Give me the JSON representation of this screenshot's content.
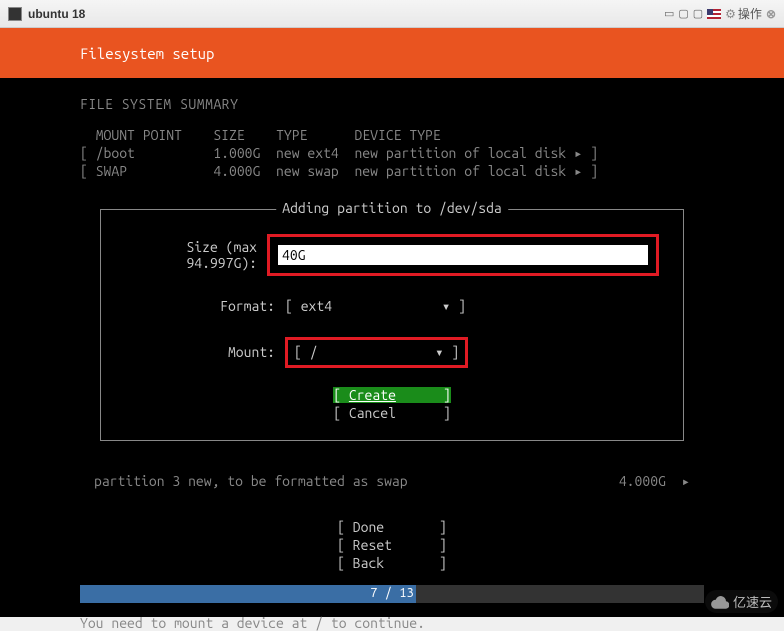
{
  "titlebar": {
    "title": "ubuntu 18",
    "operate_label": "操作"
  },
  "header": {
    "title": "Filesystem setup"
  },
  "summary": {
    "title": "FILE SYSTEM SUMMARY",
    "headers": {
      "mount": "MOUNT POINT",
      "size": "SIZE",
      "type": "TYPE",
      "device": "DEVICE TYPE"
    },
    "rows": [
      {
        "mount": "/boot",
        "size": "1.000G",
        "type": "new ext4",
        "device": "new partition of local disk"
      },
      {
        "mount": "SWAP",
        "size": "4.000G",
        "type": "new swap",
        "device": "new partition of local disk"
      }
    ]
  },
  "modal": {
    "title": "Adding partition to /dev/sda",
    "size_label": "Size (max 94.997G):",
    "size_value": "40G",
    "format_label": "Format:",
    "format_value": "ext4",
    "mount_label": "Mount:",
    "mount_value": "/",
    "create_label": "Create",
    "cancel_label": "Cancel"
  },
  "partition_line": {
    "left": "partition 3  new, to be formatted as swap",
    "right": "4.000G"
  },
  "bottom": {
    "done": "Done",
    "reset": "Reset",
    "back": "Back"
  },
  "progress": {
    "text": "7 / 13",
    "percent": 53.8
  },
  "hint": "You need to mount a device at / to continue.",
  "watermark": "亿速云"
}
